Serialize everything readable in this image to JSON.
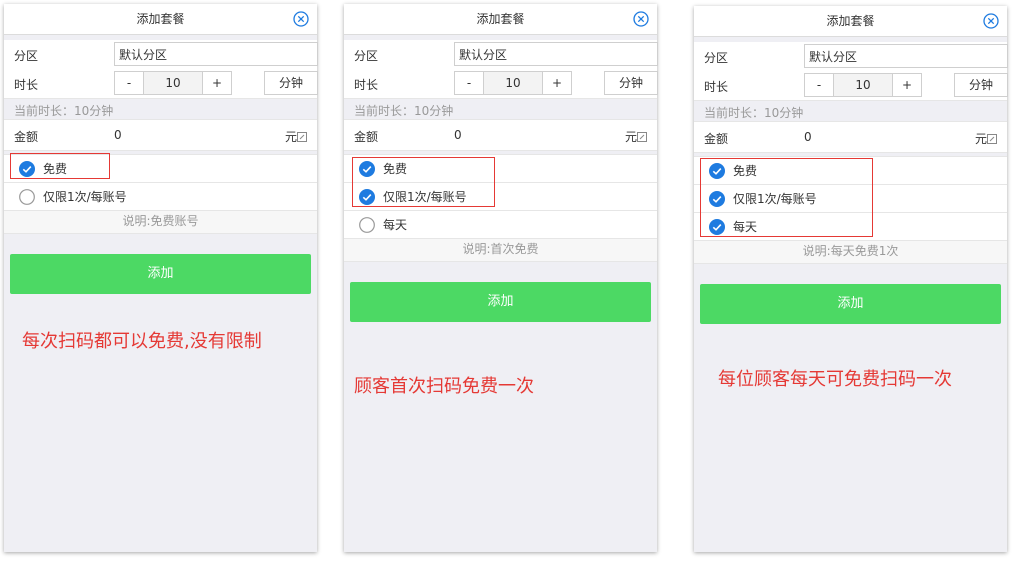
{
  "panels": [
    {
      "title": "添加套餐",
      "area_label": "分区",
      "area_value": "默认分区",
      "duration_label": "时长",
      "minus": "-",
      "duration_value": "10",
      "plus": "+",
      "unit_button": "分钟",
      "current_duration": "当前时长：10分钟",
      "amount_label": "金额",
      "amount_value": "0",
      "amount_unit": "元",
      "options": [
        {
          "label": "免费",
          "checked": true
        },
        {
          "label": "仅限1次/每账号",
          "checked": false
        }
      ],
      "note": "说明:免费账号",
      "add_button": "添加",
      "caption": "每次扫码都可以免费,没有限制"
    },
    {
      "title": "添加套餐",
      "area_label": "分区",
      "area_value": "默认分区",
      "duration_label": "时长",
      "minus": "-",
      "duration_value": "10",
      "plus": "+",
      "unit_button": "分钟",
      "current_duration": "当前时长：10分钟",
      "amount_label": "金额",
      "amount_value": "0",
      "amount_unit": "元",
      "options": [
        {
          "label": "免费",
          "checked": true
        },
        {
          "label": "仅限1次/每账号",
          "checked": true
        },
        {
          "label": "每天",
          "checked": false
        }
      ],
      "note": "说明:首次免费",
      "add_button": "添加",
      "caption": "顾客首次扫码免费一次"
    },
    {
      "title": "添加套餐",
      "area_label": "分区",
      "area_value": "默认分区",
      "duration_label": "时长",
      "minus": "-",
      "duration_value": "10",
      "plus": "+",
      "unit_button": "分钟",
      "current_duration": "当前时长：10分钟",
      "amount_label": "金额",
      "amount_value": "0",
      "amount_unit": "元",
      "options": [
        {
          "label": "免费",
          "checked": true
        },
        {
          "label": "仅限1次/每账号",
          "checked": true
        },
        {
          "label": "每天",
          "checked": true
        }
      ],
      "note": "说明:每天免费1次",
      "add_button": "添加",
      "caption": "每位顾客每天可免费扫码一次"
    }
  ],
  "colors": {
    "accent_blue": "#1e7be0",
    "add_green": "#4cd964",
    "annotation_red": "#e53935"
  },
  "icons": {
    "close": "close-circle-icon",
    "checked": "check-circle-icon",
    "unchecked": "empty-circle-icon",
    "edit": "edit-icon"
  }
}
